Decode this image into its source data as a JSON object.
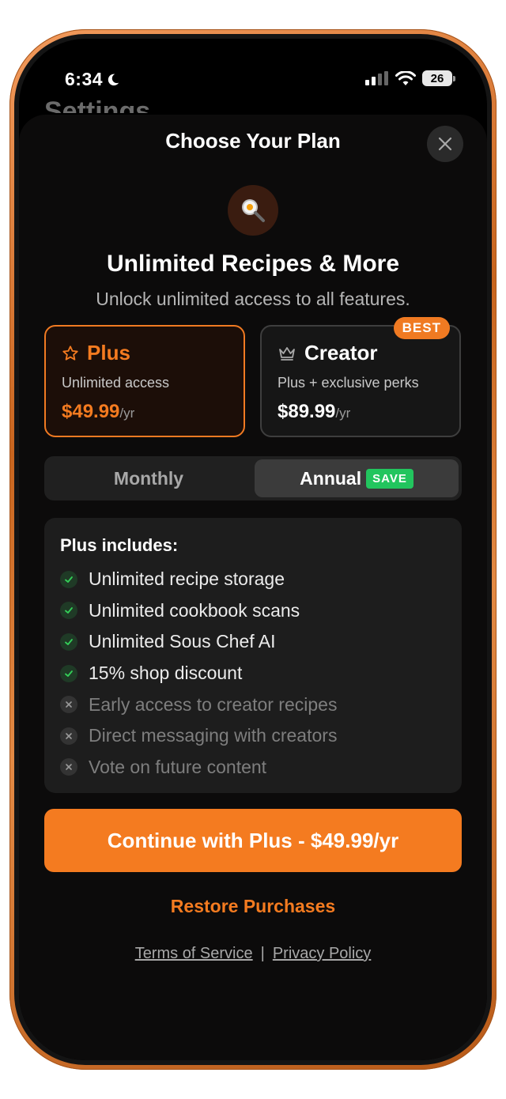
{
  "status_bar": {
    "time": "6:34",
    "battery": "26"
  },
  "background_screen": {
    "title": "Settings"
  },
  "sheet": {
    "title": "Choose Your Plan",
    "headline": "Unlimited Recipes & More",
    "subheadline": "Unlock unlimited access to all features."
  },
  "plans": {
    "plus": {
      "name": "Plus",
      "description": "Unlimited access",
      "price": "$49.99",
      "period": "/yr",
      "selected": true
    },
    "creator": {
      "name": "Creator",
      "description": "Plus + exclusive perks",
      "price": "$89.99",
      "period": "/yr",
      "badge": "BEST",
      "selected": false
    }
  },
  "billing_toggle": {
    "monthly": "Monthly",
    "annual": "Annual",
    "save_badge": "SAVE",
    "selected": "Annual"
  },
  "features": {
    "title": "Plus includes:",
    "items": [
      {
        "label": "Unlimited recipe storage",
        "included": true
      },
      {
        "label": "Unlimited cookbook scans",
        "included": true
      },
      {
        "label": "Unlimited Sous Chef AI",
        "included": true
      },
      {
        "label": "15% shop discount",
        "included": true
      },
      {
        "label": "Early access to creator recipes",
        "included": false
      },
      {
        "label": "Direct messaging with creators",
        "included": false
      },
      {
        "label": "Vote on future content",
        "included": false
      }
    ]
  },
  "cta": {
    "label": "Continue with Plus - $49.99/yr"
  },
  "restore": {
    "label": "Restore Purchases"
  },
  "legal": {
    "terms": "Terms of Service",
    "separator": "|",
    "privacy": "Privacy Policy"
  },
  "colors": {
    "accent": "#f47b20",
    "save_green": "#22c55e",
    "frame": "#d8762e"
  }
}
